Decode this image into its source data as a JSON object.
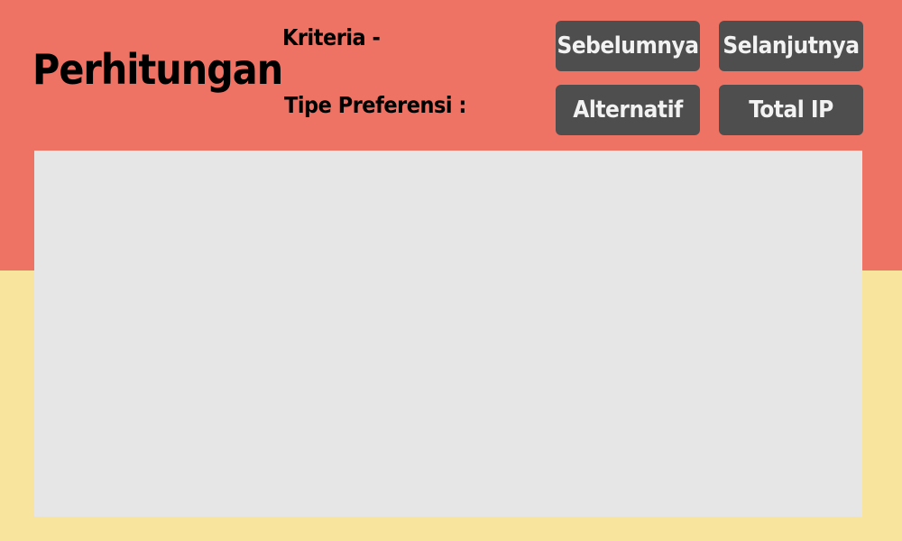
{
  "header": {
    "title": "Perhitungan",
    "criteria_label": "Kriteria -",
    "preference_type_label": "Tipe Preferensi :"
  },
  "buttons": {
    "previous": "Sebelumnya",
    "next": "Selanjutnya",
    "alternative": "Alternatif",
    "total_ip": "Total IP"
  },
  "colors": {
    "header_background": "#EF7364",
    "page_background": "#F9E49D",
    "button_background": "#4E4E4E",
    "button_text": "#F2F2F2",
    "content_panel": "#E7E6E6"
  }
}
